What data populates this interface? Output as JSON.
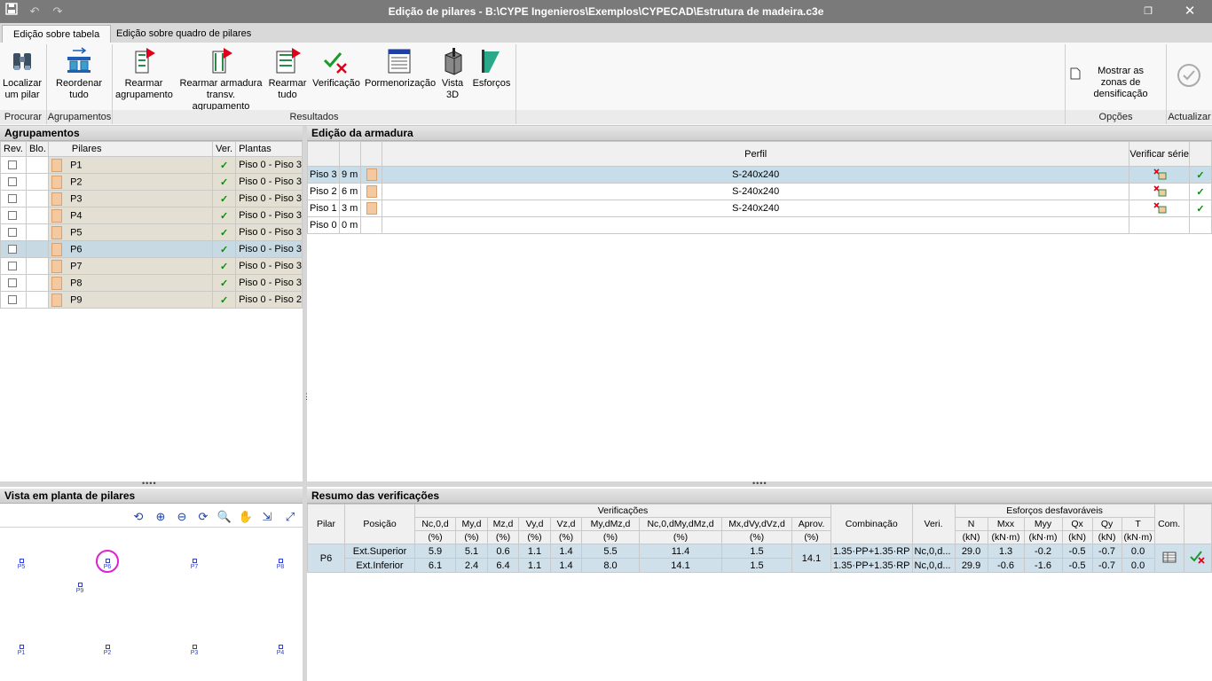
{
  "window": {
    "title": "Edição de pilares - B:\\CYPE Ingenieros\\Exemplos\\CYPECAD\\Estrutura de madeira.c3e"
  },
  "tabs": [
    "Edição sobre tabela",
    "Edição sobre quadro de pilares"
  ],
  "ribbon": {
    "buttons": [
      {
        "label": "Localizar um pilar",
        "icon": "binoculars-icon"
      },
      {
        "label": "Reordenar tudo",
        "icon": "reorder-icon"
      },
      {
        "label": "Rearmar agrupamento",
        "icon": "rearm-group-icon"
      },
      {
        "label": "Rearmar armadura transv. agrupamento",
        "icon": "rearm-transverse-icon"
      },
      {
        "label": "Rearmar tudo",
        "icon": "rearm-all-icon"
      },
      {
        "label": "Verificação",
        "icon": "verification-icon"
      },
      {
        "label": "Pormenorização",
        "icon": "detailing-icon"
      },
      {
        "label": "Vista 3D",
        "icon": "view-3d-icon"
      },
      {
        "label": "Esforços",
        "icon": "forces-icon"
      },
      {
        "label": "Mostrar as zonas de densificação",
        "icon": "document-icon"
      },
      {
        "label": "Actualizar",
        "icon": "refresh-icon"
      }
    ],
    "groups": [
      "Procurar",
      "Agrupamentos",
      "Resultados",
      "Opções",
      "Actualizar"
    ]
  },
  "agrupamentos": {
    "title": "Agrupamentos",
    "headers": [
      "Rev.",
      "Blo.",
      "Pilares",
      "Ver.",
      "Plantas"
    ],
    "rows": [
      {
        "name": "P1",
        "plantas": "Piso 0 - Piso 3"
      },
      {
        "name": "P2",
        "plantas": "Piso 0 - Piso 3"
      },
      {
        "name": "P3",
        "plantas": "Piso 0 - Piso 3"
      },
      {
        "name": "P4",
        "plantas": "Piso 0 - Piso 3"
      },
      {
        "name": "P5",
        "plantas": "Piso 0 - Piso 3"
      },
      {
        "name": "P6",
        "plantas": "Piso 0 - Piso 3"
      },
      {
        "name": "P7",
        "plantas": "Piso 0 - Piso 3"
      },
      {
        "name": "P8",
        "plantas": "Piso 0 - Piso 3"
      },
      {
        "name": "P9",
        "plantas": "Piso 0 - Piso 2"
      }
    ],
    "check": "✓"
  },
  "armadura": {
    "title": "Edição da armadura",
    "perfil_header": "Perfil",
    "verificar_header": "Verificar série",
    "rows": [
      {
        "piso": "Piso 3",
        "h": "9 m",
        "perfil": "S-240x240"
      },
      {
        "piso": "Piso 2",
        "h": "6 m",
        "perfil": "S-240x240"
      },
      {
        "piso": "Piso 1",
        "h": "3 m",
        "perfil": "S-240x240"
      },
      {
        "piso": "Piso 0",
        "h": "0 m",
        "perfil": ""
      }
    ]
  },
  "vista": {
    "title": "Vista em planta de pilares",
    "pillars": [
      "P5",
      "P6",
      "P7",
      "P8",
      "P9",
      "P1",
      "P2",
      "P3",
      "P4"
    ]
  },
  "resumo": {
    "title": "Resumo das verificações",
    "group_verificacoes": "Verificações",
    "group_esforcos": "Esforços desfavoráveis",
    "h_pilar": "Pilar",
    "h_posicao": "Posição",
    "h_combinacao": "Combinação",
    "h_veri": "Veri.",
    "h_com": "Com.",
    "verif_cols": [
      {
        "name": "Nc,0,d",
        "unit": "(%)"
      },
      {
        "name": "My,d",
        "unit": "(%)"
      },
      {
        "name": "Mz,d",
        "unit": "(%)"
      },
      {
        "name": "Vy,d",
        "unit": "(%)"
      },
      {
        "name": "Vz,d",
        "unit": "(%)"
      },
      {
        "name": "My,dMz,d",
        "unit": "(%)"
      },
      {
        "name": "Nc,0,dMy,dMz,d",
        "unit": "(%)"
      },
      {
        "name": "Mx,dVy,dVz,d",
        "unit": "(%)"
      },
      {
        "name": "Aprov.",
        "unit": "(%)"
      }
    ],
    "esf_cols": [
      {
        "name": "N",
        "unit": "(kN)"
      },
      {
        "name": "Mxx",
        "unit": "(kN·m)"
      },
      {
        "name": "Myy",
        "unit": "(kN·m)"
      },
      {
        "name": "Qx",
        "unit": "(kN)"
      },
      {
        "name": "Qy",
        "unit": "(kN)"
      },
      {
        "name": "T",
        "unit": "(kN·m)"
      }
    ],
    "pilar": "P6",
    "aprov": "14.1",
    "rows": [
      {
        "pos": "Ext.Superior",
        "v": [
          "5.9",
          "5.1",
          "0.6",
          "1.1",
          "1.4",
          "5.5",
          "11.4",
          "1.5"
        ],
        "comb": "1.35·PP+1.35·RP",
        "veri": "Nc,0,d...",
        "e": [
          "29.0",
          "1.3",
          "-0.2",
          "-0.5",
          "-0.7",
          "0.0"
        ]
      },
      {
        "pos": "Ext.Inferior",
        "v": [
          "6.1",
          "2.4",
          "6.4",
          "1.1",
          "1.4",
          "8.0",
          "14.1",
          "1.5"
        ],
        "comb": "1.35·PP+1.35·RP",
        "veri": "Nc,0,d...",
        "e": [
          "29.9",
          "-0.6",
          "-1.6",
          "-0.5",
          "-0.7",
          "0.0"
        ]
      }
    ]
  }
}
